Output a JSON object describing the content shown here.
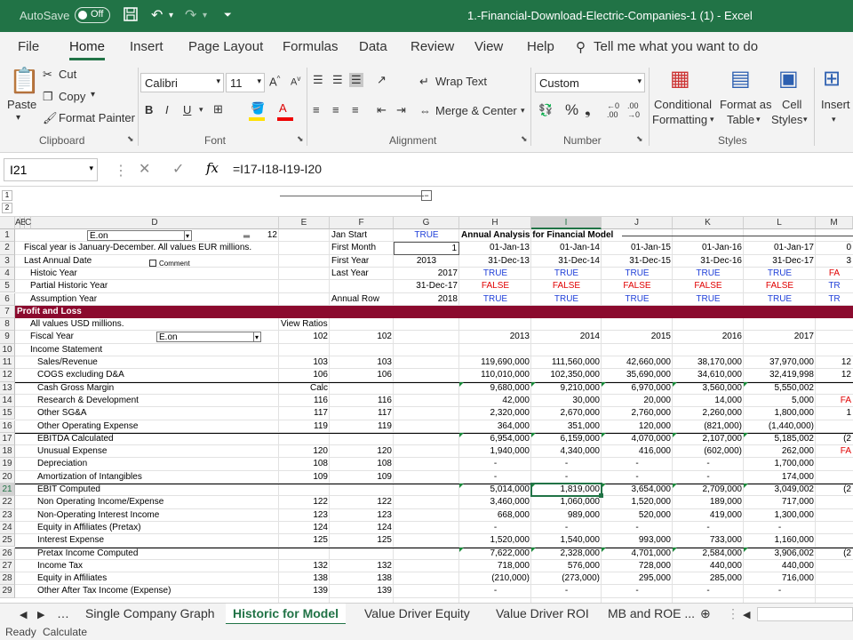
{
  "titlebar": {
    "autosave": "AutoSave",
    "autosave_state": "Off",
    "document": "1.-Financial-Download-Electric-Companies-1 (1)  -  Excel"
  },
  "ribbon_tabs": [
    "File",
    "Home",
    "Insert",
    "Page Layout",
    "Formulas",
    "Data",
    "Review",
    "View",
    "Help"
  ],
  "tell_me": "Tell me what you want to do",
  "ribbon": {
    "paste": "Paste",
    "cut": "Cut",
    "copy": "Copy",
    "format_painter": "Format Painter",
    "font_name": "Calibri",
    "font_size": "11",
    "wrap_text": "Wrap Text",
    "merge_center": "Merge & Center",
    "number_format": "Custom",
    "conditional_formatting_1": "Conditional",
    "conditional_formatting_2": "Formatting",
    "format_as_table_1": "Format as",
    "format_as_table_2": "Table",
    "cell_styles_1": "Cell",
    "cell_styles_2": "Styles",
    "insert": "Insert",
    "groups": {
      "clipboard": "Clipboard",
      "font": "Font",
      "alignment": "Alignment",
      "number": "Number",
      "styles": "Styles"
    }
  },
  "formula_bar": {
    "name_box": "I21",
    "fx": "fx",
    "formula": "=I17-I18-I19-I20"
  },
  "columns": [
    "A",
    "B",
    "C",
    "D",
    "E",
    "F",
    "G",
    "H",
    "I",
    "J",
    "K",
    "L",
    "M"
  ],
  "rows": [
    "1",
    "2",
    "3",
    "4",
    "5",
    "6",
    "7",
    "8",
    "9",
    "10",
    "11",
    "12",
    "13",
    "14",
    "15",
    "16",
    "17",
    "18",
    "19",
    "20",
    "21",
    "22",
    "23",
    "24",
    "25",
    "26",
    "27",
    "28",
    "29"
  ],
  "top_cells": {
    "d1_dropdown": "E.on",
    "e1": "12",
    "d2": "Fiscal year is January-December. All values EUR millions.",
    "d3": "Last Annual Date",
    "comment_label": "Comment",
    "d4": "Histoic Year",
    "d5": "Partial Historic Year",
    "d6": "Assumption Year",
    "f1": "Jan Start",
    "f2": "First Month",
    "f3": "First Year",
    "f4": "Last Year",
    "f6": "Annual Row",
    "g1": "TRUE",
    "g2": "1",
    "g3": "2013",
    "g4": "2017",
    "g5": "31-Dec-17",
    "g6": "2018",
    "h1": "Annual Analysis for Financial Model",
    "pl_header": "Profit and Loss",
    "d8": "All values USD millions.",
    "e8": "View Ratios",
    "d9": "Fiscal Year",
    "d9_dropdown": "E.on",
    "e9": "102",
    "f9": "102",
    "d10": "Income Statement"
  },
  "period_cols": [
    "H",
    "I",
    "J",
    "K",
    "L",
    "M"
  ],
  "period_rows": {
    "r2": [
      "01-Jan-13",
      "01-Jan-14",
      "01-Jan-15",
      "01-Jan-16",
      "01-Jan-17",
      "0"
    ],
    "r3": [
      "31-Dec-13",
      "31-Dec-14",
      "31-Dec-15",
      "31-Dec-16",
      "31-Dec-17",
      "3"
    ],
    "r4": [
      "TRUE",
      "TRUE",
      "TRUE",
      "TRUE",
      "TRUE",
      "FA"
    ],
    "r5": [
      "FALSE",
      "FALSE",
      "FALSE",
      "FALSE",
      "FALSE",
      "TR"
    ],
    "r6": [
      "TRUE",
      "TRUE",
      "TRUE",
      "TRUE",
      "TRUE",
      "TR"
    ],
    "r9": [
      "2013",
      "2014",
      "2015",
      "2016",
      "2017",
      ""
    ]
  },
  "line_items": [
    {
      "row": 11,
      "label": "Sales/Revenue",
      "e": "103",
      "f": "103",
      "v": [
        "119,690,000",
        "111,560,000",
        "42,660,000",
        "38,170,000",
        "37,970,000",
        "12"
      ]
    },
    {
      "row": 12,
      "label": "COGS excluding D&A",
      "e": "106",
      "f": "106",
      "v": [
        "110,010,000",
        "102,350,000",
        "35,690,000",
        "34,610,000",
        "32,419,998",
        "12"
      ]
    },
    {
      "row": 13,
      "label": "Cash Gross Margin",
      "e": "Calc",
      "f": "",
      "v": [
        "9,680,000",
        "9,210,000",
        "6,970,000",
        "3,560,000",
        "5,550,002",
        ""
      ]
    },
    {
      "row": 14,
      "label": "Research & Development",
      "e": "116",
      "f": "116",
      "v": [
        "42,000",
        "30,000",
        "20,000",
        "14,000",
        "5,000",
        "FA"
      ]
    },
    {
      "row": 15,
      "label": "Other SG&A",
      "e": "117",
      "f": "117",
      "v": [
        "2,320,000",
        "2,670,000",
        "2,760,000",
        "2,260,000",
        "1,800,000",
        "1"
      ]
    },
    {
      "row": 16,
      "label": "Other Operating Expense",
      "e": "119",
      "f": "119",
      "v": [
        "364,000",
        "351,000",
        "120,000",
        "(821,000)",
        "(1,440,000)",
        ""
      ]
    },
    {
      "row": 17,
      "label": "EBITDA Calculated",
      "e": "",
      "f": "",
      "v": [
        "6,954,000",
        "6,159,000",
        "4,070,000",
        "2,107,000",
        "5,185,002",
        "(2"
      ]
    },
    {
      "row": 18,
      "label": "Unusual Expense",
      "e": "120",
      "f": "120",
      "v": [
        "1,940,000",
        "4,340,000",
        "416,000",
        "(602,000)",
        "262,000",
        "FA"
      ]
    },
    {
      "row": 19,
      "label": "Depreciation",
      "e": "108",
      "f": "108",
      "v": [
        "-",
        "-",
        "-",
        "-",
        "1,700,000",
        ""
      ]
    },
    {
      "row": 20,
      "label": "Amortization of Intangibles",
      "e": "109",
      "f": "109",
      "v": [
        "-",
        "-",
        "-",
        "-",
        "174,000",
        ""
      ]
    },
    {
      "row": 21,
      "label": "EBIT Computed",
      "e": "",
      "f": "",
      "v": [
        "5,014,000",
        "1,819,000",
        "3,654,000",
        "2,709,000",
        "3,049,002",
        "(2"
      ]
    },
    {
      "row": 22,
      "label": "Non Operating Income/Expense",
      "e": "122",
      "f": "122",
      "v": [
        "3,460,000",
        "1,060,000",
        "1,520,000",
        "189,000",
        "717,000",
        ""
      ]
    },
    {
      "row": 23,
      "label": "Non-Operating Interest Income",
      "e": "123",
      "f": "123",
      "v": [
        "668,000",
        "989,000",
        "520,000",
        "419,000",
        "1,300,000",
        ""
      ]
    },
    {
      "row": 24,
      "label": "Equity in Affiliates (Pretax)",
      "e": "124",
      "f": "124",
      "v": [
        "-",
        "-",
        "-",
        "-",
        "-",
        ""
      ]
    },
    {
      "row": 25,
      "label": "Interest Expense",
      "e": "125",
      "f": "125",
      "v": [
        "1,520,000",
        "1,540,000",
        "993,000",
        "733,000",
        "1,160,000",
        ""
      ]
    },
    {
      "row": 26,
      "label": "Pretax Income Computed",
      "e": "",
      "f": "",
      "v": [
        "7,622,000",
        "2,328,000",
        "4,701,000",
        "2,584,000",
        "3,906,002",
        "(2"
      ]
    },
    {
      "row": 27,
      "label": "Income Tax",
      "e": "132",
      "f": "132",
      "v": [
        "718,000",
        "576,000",
        "728,000",
        "440,000",
        "440,000",
        ""
      ]
    },
    {
      "row": 28,
      "label": "Equity in Affiliates",
      "e": "138",
      "f": "138",
      "v": [
        "(210,000)",
        "(273,000)",
        "295,000",
        "285,000",
        "716,000",
        ""
      ]
    },
    {
      "row": 29,
      "label": "Other After Tax Income (Expense)",
      "e": "139",
      "f": "139",
      "v": [
        "-",
        "-",
        "-",
        "-",
        "-",
        ""
      ]
    }
  ],
  "sheet_tabs": [
    "Single Company Graph",
    "Historic for Model",
    "Value Driver Equity",
    "Value Driver ROI",
    "MB and ROE ..."
  ],
  "active_sheet": "Historic for Model",
  "status": {
    "ready": "Ready",
    "calculate": "Calculate"
  }
}
